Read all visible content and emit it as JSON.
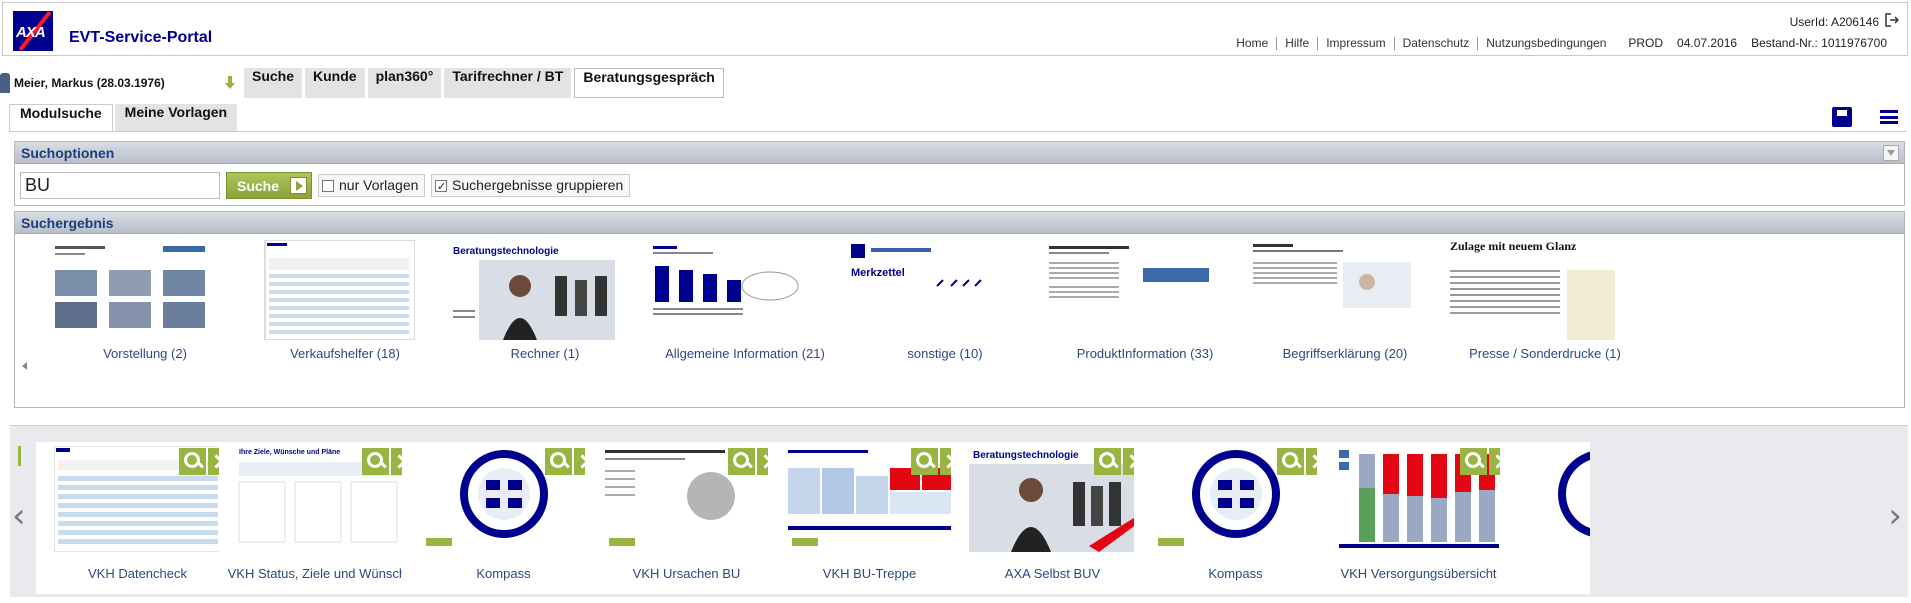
{
  "header": {
    "logo": "AXA",
    "title": "EVT-Service-Portal",
    "userid": "UserId: A206146",
    "links": [
      "Home",
      "Hilfe",
      "Impressum",
      "Datenschutz",
      "Nutzungsbedingungen"
    ],
    "env": "PROD",
    "date": "04.07.2016",
    "bestand": "Bestand-Nr.: 1011976700"
  },
  "customer": {
    "name": "Meier, Markus (28.03.1976)"
  },
  "nav": {
    "tabs": [
      "Suche",
      "Kunde",
      "plan360°",
      "Tarifrechner / BT",
      "Beratungsgespräch"
    ],
    "active": "Beratungsgespräch"
  },
  "subtabs": [
    "Modulsuche",
    "Meine Vorlagen"
  ],
  "search": {
    "heading": "Suchoptionen",
    "value": "BU",
    "button": "Suche",
    "opt_vorlagen": "nur Vorlagen",
    "opt_gruppieren": "Suchergebnisse gruppieren",
    "gruppieren_checked": true
  },
  "results": {
    "heading": "Suchergebnis",
    "items": [
      "Vorstellung (2)",
      "Verkaufshelfer (18)",
      "Rechner (1)",
      "Allgemeine Information (21)",
      "sonstige (10)",
      "ProduktInformation (33)",
      "Begriffserklärung (20)",
      "Presse / Sonderdrucke (1)"
    ],
    "thumb_texts": {
      "rechner": "Beratungstechnologie",
      "sonstige": "Merkzettel",
      "presse": "Zulage mit neuem Glanz"
    }
  },
  "strip": {
    "cards": [
      "VKH Datencheck",
      "VKH Status, Ziele und Wünsche",
      "Kompass",
      "VKH Ursachen BU",
      "VKH BU-Treppe",
      "AXA Selbst BUV",
      "Kompass",
      "VKH Versorgungsübersicht"
    ],
    "card_texts": {
      "status": "Ihre Ziele, Wünsche und Pläne",
      "buv": "Beratungstechnologie"
    }
  },
  "colors": {
    "brand": "#00008f",
    "accent": "#9ab441",
    "axa_red": "#ff1721"
  }
}
